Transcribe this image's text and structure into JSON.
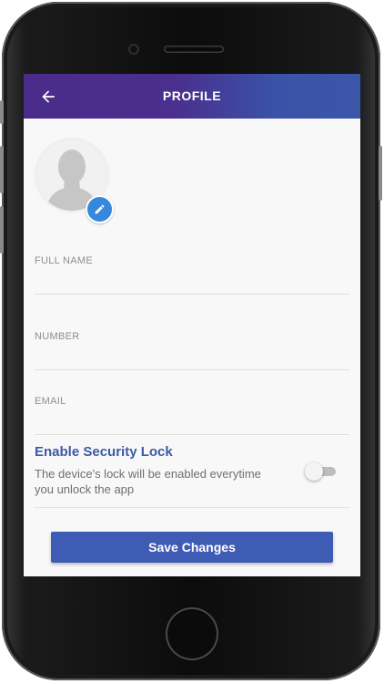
{
  "app": {
    "title": "PROFILE"
  },
  "icons": {
    "back": "arrow-left-icon",
    "edit": "pencil-icon",
    "avatar": "person-silhouette-icon"
  },
  "form": {
    "full_name": {
      "label": "FULL NAME",
      "value": ""
    },
    "number": {
      "label": "NUMBER",
      "value": ""
    },
    "email": {
      "label": "EMAIL",
      "value": ""
    }
  },
  "security": {
    "title": "Enable Security Lock",
    "description": "The device's lock will be enabled everytime you unlock the app",
    "enabled": false
  },
  "actions": {
    "save_label": "Save Changes"
  },
  "colors": {
    "appbar_start": "#4a2b8a",
    "appbar_end": "#3b56a9",
    "accent": "#3f5cb5",
    "edit_badge": "#3588dd",
    "security_title": "#3c5aa7"
  }
}
